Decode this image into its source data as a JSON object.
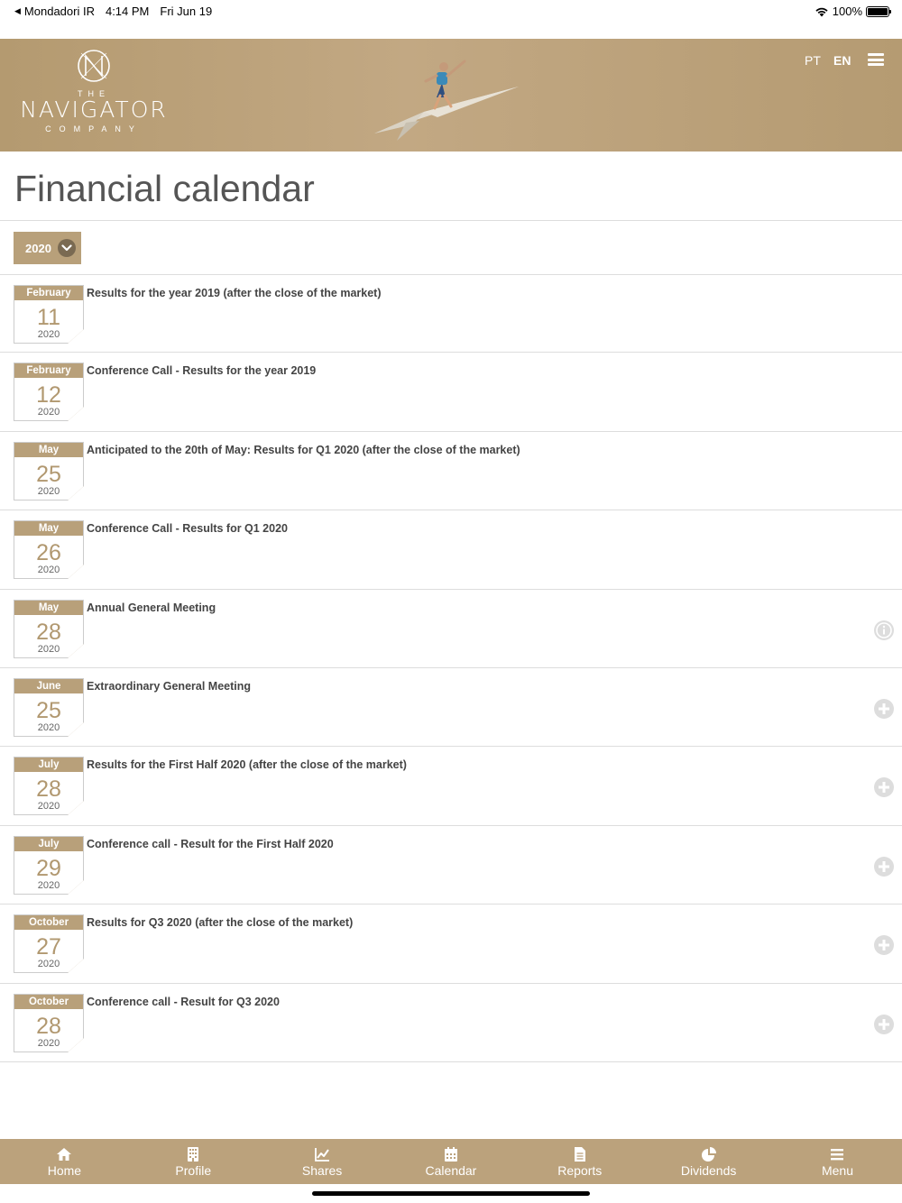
{
  "status_bar": {
    "back_app": "Mondadori IR",
    "time": "4:14 PM",
    "date": "Fri Jun 19",
    "battery": "100%"
  },
  "header": {
    "logo": {
      "the": "THE",
      "name": "NAVIGATOR",
      "company": "COMPANY"
    },
    "lang_pt": "PT",
    "lang_en": "EN",
    "active_lang": "EN"
  },
  "page": {
    "title": "Financial calendar"
  },
  "year_filter": {
    "selected": "2020"
  },
  "events": [
    {
      "month": "February",
      "day": "11",
      "year": "2020",
      "title": "Results for the year 2019 (after the close of the market)",
      "action": ""
    },
    {
      "month": "February",
      "day": "12",
      "year": "2020",
      "title": "Conference Call - Results for the year 2019",
      "action": ""
    },
    {
      "month": "May",
      "day": "25",
      "year": "2020",
      "title": "Anticipated to the 20th of May: Results for Q1 2020 (after the close of the market)",
      "action": ""
    },
    {
      "month": "May",
      "day": "26",
      "year": "2020",
      "title": "Conference Call - Results for Q1 2020",
      "action": ""
    },
    {
      "month": "May",
      "day": "28",
      "year": "2020",
      "title": "Annual General Meeting",
      "action": "info-icon"
    },
    {
      "month": "June",
      "day": "25",
      "year": "2020",
      "title": "Extraordinary General Meeting",
      "action": "plus-icon"
    },
    {
      "month": "July",
      "day": "28",
      "year": "2020",
      "title": "Results for the First Half 2020 (after the close of the market)",
      "action": "plus-icon"
    },
    {
      "month": "July",
      "day": "29",
      "year": "2020",
      "title": "Conference call - Result for the First Half 2020",
      "action": "plus-icon"
    },
    {
      "month": "October",
      "day": "27",
      "year": "2020",
      "title": "Results for Q3 2020 (after the close of the market)",
      "action": "plus-icon"
    },
    {
      "month": "October",
      "day": "28",
      "year": "2020",
      "title": "Conference call - Result for Q3 2020",
      "action": "plus-icon"
    }
  ],
  "tabbar": [
    {
      "label": "Home",
      "icon": "home-icon"
    },
    {
      "label": "Profile",
      "icon": "building-icon"
    },
    {
      "label": "Shares",
      "icon": "chart-line-icon"
    },
    {
      "label": "Calendar",
      "icon": "calendar-icon"
    },
    {
      "label": "Reports",
      "icon": "document-icon"
    },
    {
      "label": "Dividends",
      "icon": "pie-chart-icon"
    },
    {
      "label": "Menu",
      "icon": "menu-icon"
    }
  ],
  "colors": {
    "brand_gold": "#b8a07a",
    "header_gold": "#c2a883",
    "chevron_dark": "#7a6a52",
    "day_text": "#b19870"
  }
}
